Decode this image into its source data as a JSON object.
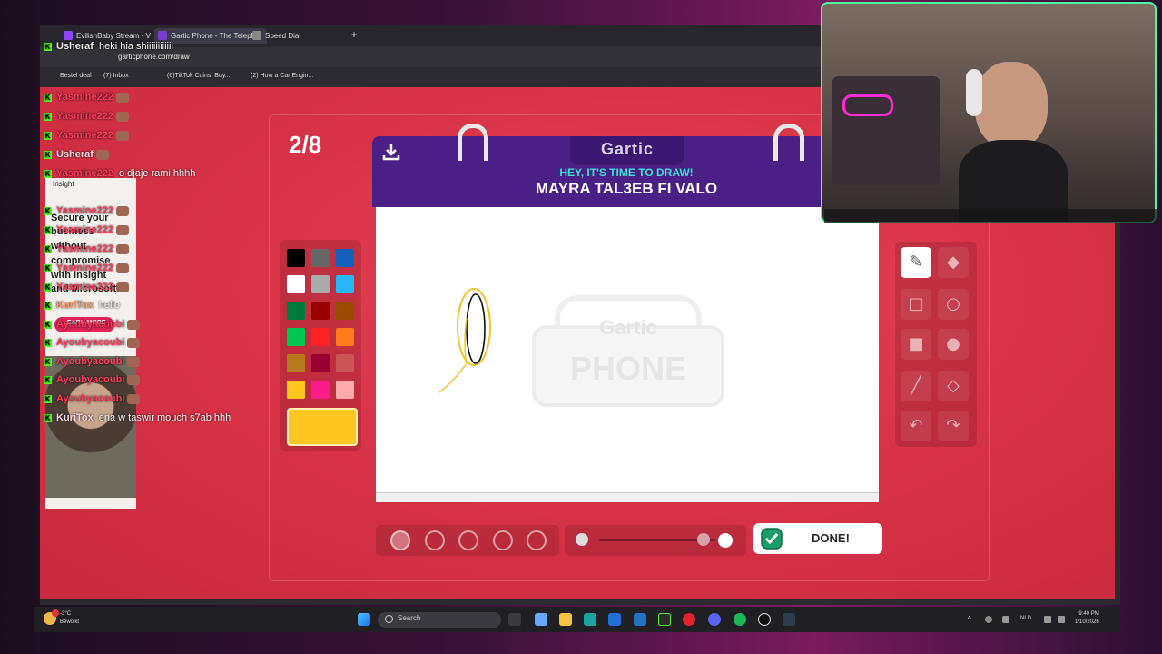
{
  "browser": {
    "tabs": [
      "EvilishBaby Stream - V",
      "Gartic Phone - The Teleph",
      "Speed Dial"
    ],
    "url": "garticphone.com/draw",
    "bookmarks": [
      "Bestel deal",
      "(7) Inbox",
      "(6)TikTok Coins: Buy...",
      "(2) How a Car Engin..."
    ]
  },
  "game": {
    "round": "2/8",
    "logo": "Gartic",
    "hint": "HEY, IT'S TIME TO DRAW!",
    "topic": "MAYRA TAL3EB FI VALO",
    "done_label": "DONE!",
    "watermark_top": "Gartic",
    "watermark_bottom": "PHONE",
    "palette": [
      "#000000",
      "#666666",
      "#1560bd",
      "#ffffff",
      "#aaaaaa",
      "#29b6f6",
      "#007a3d",
      "#990000",
      "#994c00",
      "#00c853",
      "#ff2222",
      "#ff7a1a",
      "#b8791e",
      "#990033",
      "#cc5555",
      "#ffc720",
      "#ff1a8c",
      "#ffaaaa"
    ],
    "selected_color": "#ffc720",
    "tools": [
      "pencil-icon",
      "eraser-icon",
      "rectangle-outline-icon",
      "circle-outline-icon",
      "rectangle-fill-icon",
      "circle-fill-icon",
      "line-icon",
      "fill-bucket-icon",
      "undo-icon",
      "redo-icon"
    ],
    "selected_tool": "pencil-icon"
  },
  "chat": [
    {
      "user": "Usheraf",
      "msg": "heki hia shiiiiiiiiiiii",
      "color": "#e8e8e8"
    },
    {
      "user": "Yasmine222",
      "msg": "",
      "color": "#ff3b5c"
    },
    {
      "user": "Yasmine222",
      "msg": "",
      "color": "#ff3b5c"
    },
    {
      "user": "Yasmine222",
      "msg": "",
      "color": "#ff3b5c"
    },
    {
      "user": "Usheraf",
      "msg": "",
      "color": "#ffd6e0"
    },
    {
      "user": "Yasmine222",
      "msg": "o djaje rami hhhh",
      "color": "#ff3b5c"
    },
    {
      "user": "Yasmine222",
      "msg": "",
      "color": "#ff3b5c"
    },
    {
      "user": "Yasmine222",
      "msg": "",
      "color": "#ff3b5c"
    },
    {
      "user": "Yasmine222",
      "msg": "",
      "color": "#ff3b5c"
    },
    {
      "user": "Yasmine222",
      "msg": "",
      "color": "#ff3b5c"
    },
    {
      "user": "Yasmine222",
      "msg": "",
      "color": "#ff3b5c"
    },
    {
      "user": "KuriTox",
      "msg": "hello",
      "color": "#ff9c6a"
    },
    {
      "user": "Ayoubyacoubi",
      "msg": "",
      "color": "#ff3b5c"
    },
    {
      "user": "Ayoubyacoubi",
      "msg": "",
      "color": "#ff3b5c"
    },
    {
      "user": "Ayoubyacoubi",
      "msg": "",
      "color": "#ff3b5c"
    },
    {
      "user": "Ayoubyacoubi",
      "msg": "",
      "color": "#ff3b5c"
    },
    {
      "user": "Ayoubyacoubi",
      "msg": "",
      "color": "#ff3b5c"
    },
    {
      "user": "KuriTox",
      "msg": "ena w taswir mouch s7ab hhh",
      "color": "#ffd6e0"
    }
  ],
  "ad": {
    "brand": "Insight",
    "lines": [
      "Secure your",
      "business",
      "without",
      "compromise",
      "with Insight",
      "and Microsoft"
    ],
    "button": "LEARN MORE"
  },
  "taskbar": {
    "weather_temp": "-3°C",
    "weather_text": "Bewolkt",
    "search_placeholder": "Search",
    "language": "NLD",
    "time": "9:40 PM",
    "date": "1/10/2026"
  }
}
